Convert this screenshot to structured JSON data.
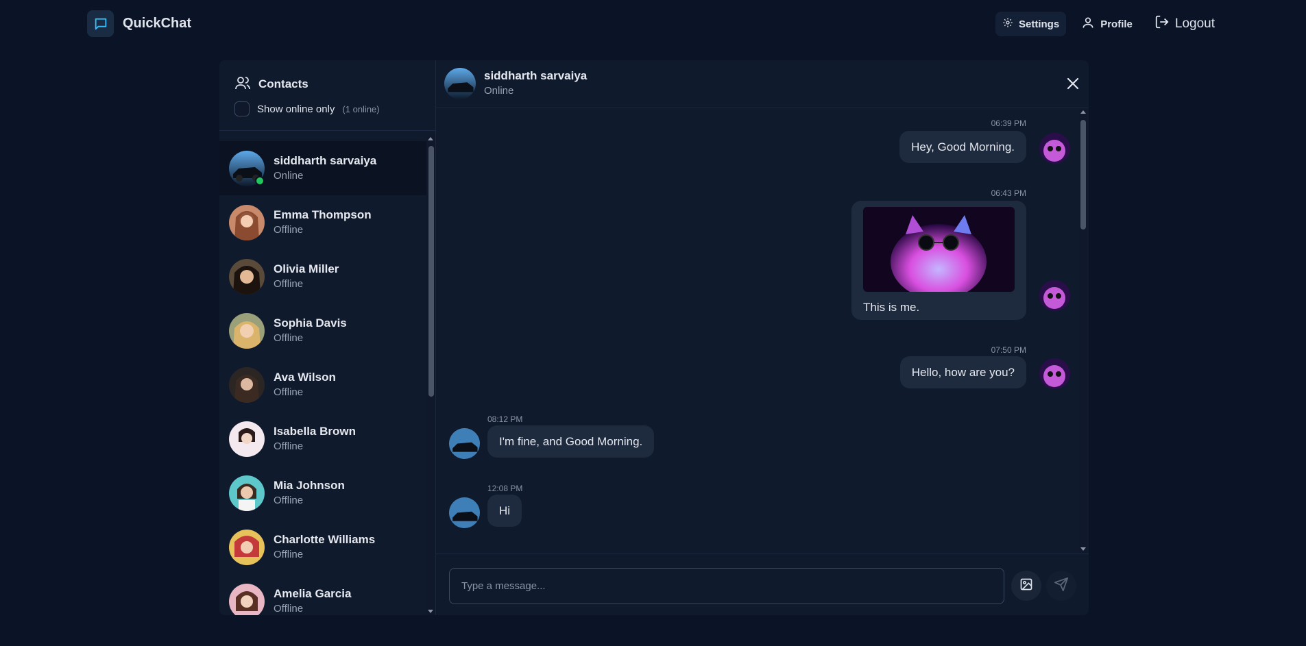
{
  "app": {
    "name": "QuickChat"
  },
  "nav": {
    "settings": "Settings",
    "profile": "Profile",
    "logout": "Logout"
  },
  "sidebar": {
    "title": "Contacts",
    "filter_label": "Show online only",
    "online_count": "(1 online)",
    "contacts": [
      {
        "name": "siddharth sarvaiya",
        "status": "Online",
        "avatar": "car-photo-avatar"
      },
      {
        "name": "Emma Thompson",
        "status": "Offline",
        "avatar": "woman-photo-avatar"
      },
      {
        "name": "Olivia Miller",
        "status": "Offline",
        "avatar": "woman-photo-avatar"
      },
      {
        "name": "Sophia Davis",
        "status": "Offline",
        "avatar": "woman-photo-avatar"
      },
      {
        "name": "Ava Wilson",
        "status": "Offline",
        "avatar": "woman-photo-avatar"
      },
      {
        "name": "Isabella Brown",
        "status": "Offline",
        "avatar": "woman-photo-avatar"
      },
      {
        "name": "Mia Johnson",
        "status": "Offline",
        "avatar": "woman-photo-avatar"
      },
      {
        "name": "Charlotte Williams",
        "status": "Offline",
        "avatar": "woman-photo-avatar"
      },
      {
        "name": "Amelia Garcia",
        "status": "Offline",
        "avatar": "woman-photo-avatar"
      }
    ]
  },
  "chat": {
    "contact_name": "siddharth sarvaiya",
    "contact_status": "Online",
    "messages": [
      {
        "time": "06:39 PM",
        "text": "Hey, Good Morning.",
        "sender": "me"
      },
      {
        "time": "06:43 PM",
        "text": "This is me.",
        "sender": "me",
        "image": "cat-with-sunglasses-photo"
      },
      {
        "time": "07:50 PM",
        "text": "Hello, how are you?",
        "sender": "me"
      },
      {
        "time": "08:12 PM",
        "text": "I'm fine, and Good Morning.",
        "sender": "them"
      },
      {
        "time": "12:08 PM",
        "text": "Hi",
        "sender": "them"
      }
    ],
    "input_placeholder": "Type a message..."
  },
  "colors": {
    "background": "#0b1426",
    "panel": "#101a2d",
    "bubble": "#1e2a3d",
    "accent": "#38bdf8",
    "online": "#22c55e"
  }
}
